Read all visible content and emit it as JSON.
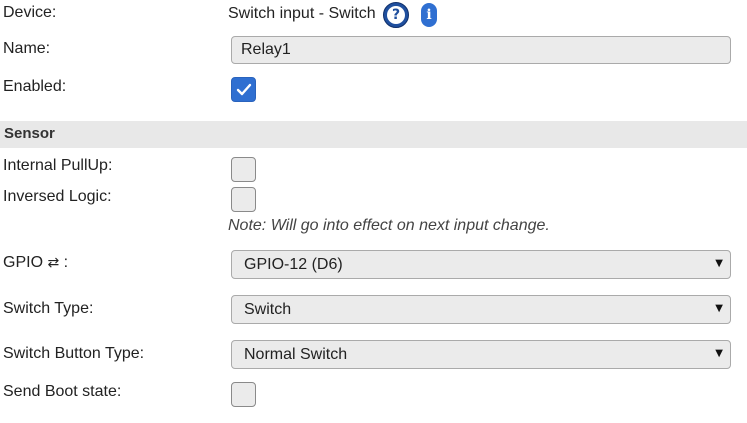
{
  "device": {
    "label": "Device:",
    "value": "Switch input - Switch",
    "help_icon": "question-circle-icon",
    "info_icon": "info-icon"
  },
  "name": {
    "label": "Name:",
    "value": "Relay1"
  },
  "enabled": {
    "label": "Enabled:",
    "checked": true
  },
  "sensor_section": {
    "title": "Sensor"
  },
  "internal_pullup": {
    "label": "Internal PullUp:",
    "checked": false
  },
  "inversed_logic": {
    "label": "Inversed Logic:",
    "checked": false,
    "note": "Note: Will go into effect on next input change."
  },
  "gpio": {
    "label": "GPIO",
    "arrows": "⇄",
    "colon": ":",
    "selected": "GPIO-12 (D6)"
  },
  "switch_type": {
    "label": "Switch Type:",
    "selected": "Switch"
  },
  "switch_button_type": {
    "label": "Switch Button Type:",
    "selected": "Normal Switch"
  },
  "send_boot_state": {
    "label": "Send Boot state:",
    "checked": false
  },
  "colors": {
    "accent": "#2f6fd1",
    "section_bg": "#e8e8e8",
    "input_bg": "#ebebeb"
  }
}
